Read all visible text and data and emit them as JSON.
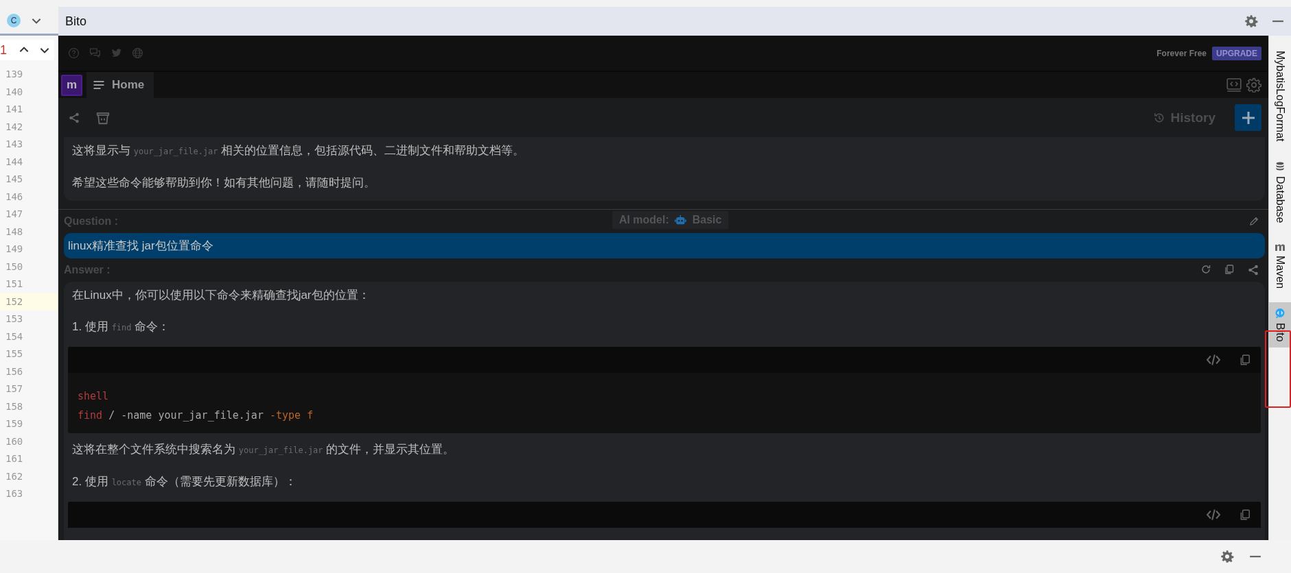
{
  "editor": {
    "file_icon": "C",
    "find_count": "1",
    "lines": [
      {
        "number": "139",
        "current": false
      },
      {
        "number": "140",
        "current": false
      },
      {
        "number": "141",
        "current": false
      },
      {
        "number": "142",
        "current": false
      },
      {
        "number": "143",
        "current": false
      },
      {
        "number": "144",
        "current": false
      },
      {
        "number": "145",
        "current": false
      },
      {
        "number": "146",
        "current": false
      },
      {
        "number": "147",
        "current": false
      },
      {
        "number": "148",
        "current": false
      },
      {
        "number": "149",
        "current": false
      },
      {
        "number": "150",
        "current": false
      },
      {
        "number": "151",
        "current": false
      },
      {
        "number": "152",
        "current": true
      },
      {
        "number": "153",
        "current": false
      },
      {
        "number": "154",
        "current": false
      },
      {
        "number": "155",
        "current": false
      },
      {
        "number": "156",
        "current": false
      },
      {
        "number": "157",
        "current": false
      },
      {
        "number": "158",
        "current": false
      },
      {
        "number": "159",
        "current": false
      },
      {
        "number": "160",
        "current": false
      },
      {
        "number": "161",
        "current": false
      },
      {
        "number": "162",
        "current": false
      },
      {
        "number": "163",
        "current": false
      }
    ]
  },
  "tool_window": {
    "title": "Bito"
  },
  "bito": {
    "plan": "Forever Free",
    "upgrade": "UPGRADE",
    "avatar": "m",
    "tabs": [
      {
        "label": "Home",
        "selected": true
      }
    ],
    "history": "History",
    "ai_model": {
      "label": "AI model:",
      "value": "Basic"
    },
    "previous_answer": [
      {
        "kind": "paragraph",
        "parts": [
          {
            "text": "这将显示与 "
          },
          {
            "code": "your_jar_file.jar"
          },
          {
            "text": " 相关的位置信息，包括源代码、二进制文件和帮助文档等。"
          }
        ]
      },
      {
        "kind": "paragraph",
        "parts": [
          {
            "text": "希望这些命令能够帮助到你！如有其他问题，请随时提问。"
          }
        ]
      }
    ],
    "question": {
      "label": "Question :",
      "text": "linux精准查找 jar包位置命令"
    },
    "answer": {
      "label": "Answer :",
      "blocks": [
        {
          "kind": "paragraph",
          "parts": [
            {
              "text": "在Linux中，你可以使用以下命令来精确查找jar包的位置："
            }
          ]
        },
        {
          "kind": "paragraph",
          "parts": [
            {
              "text": "1. 使用 "
            },
            {
              "code": "find"
            },
            {
              "text": " 命令："
            }
          ]
        },
        {
          "kind": "code",
          "lines": [
            [
              {
                "text": "shell",
                "kind": "keyword"
              }
            ],
            [
              {
                "text": "find",
                "kind": "keyword"
              },
              {
                "text": " / -name your_jar_file.jar ",
                "kind": "plain"
              },
              {
                "text": "-type f",
                "kind": "flag"
              }
            ]
          ]
        },
        {
          "kind": "paragraph",
          "parts": [
            {
              "text": "这将在整个文件系统中搜索名为 "
            },
            {
              "code": "your_jar_file.jar"
            },
            {
              "text": " 的文件，并显示其位置。"
            }
          ]
        },
        {
          "kind": "paragraph",
          "parts": [
            {
              "text": "2. 使用 "
            },
            {
              "code": "locate"
            },
            {
              "text": " 命令（需要先更新数据库）："
            }
          ]
        },
        {
          "kind": "code"
        }
      ]
    }
  },
  "right_stripe": [
    {
      "label": "MybatisLogFormat",
      "selected": false,
      "kind": "text"
    },
    {
      "label": "Database",
      "selected": false,
      "kind": "database"
    },
    {
      "label": "Maven",
      "selected": false,
      "kind": "maven"
    },
    {
      "label": "Bito",
      "selected": true,
      "kind": "bito"
    }
  ]
}
